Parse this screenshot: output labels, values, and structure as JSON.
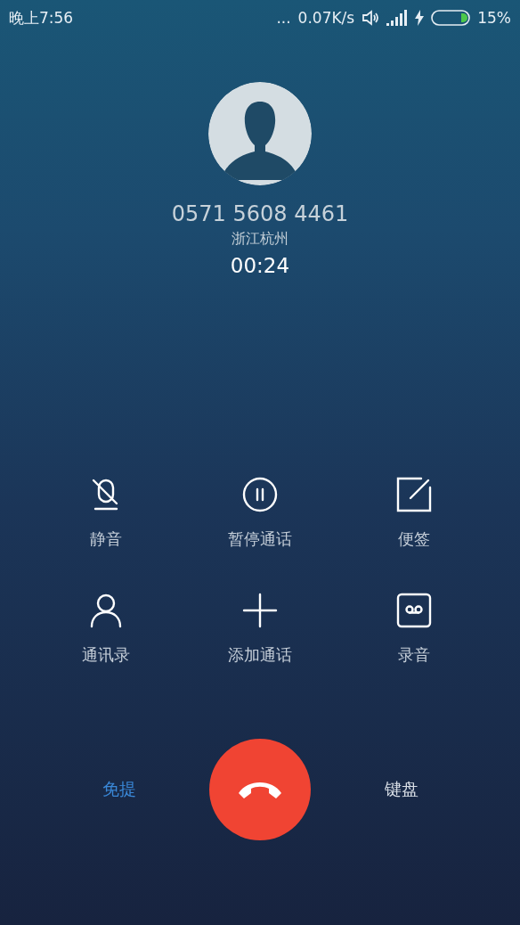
{
  "status_bar": {
    "time": "晚上7:56",
    "more": "...",
    "speed": "0.07K/s",
    "battery_percent": "15%"
  },
  "call": {
    "number": "0571 5608 4461",
    "location": "浙江杭州",
    "duration": "00:24"
  },
  "actions": [
    {
      "kind": "mute",
      "label": "静音"
    },
    {
      "kind": "hold",
      "label": "暂停通话"
    },
    {
      "kind": "note",
      "label": "便签"
    },
    {
      "kind": "contacts",
      "label": "通讯录"
    },
    {
      "kind": "add",
      "label": "添加通话"
    },
    {
      "kind": "record",
      "label": "录音"
    }
  ],
  "speaker": {
    "label": "免提",
    "on": true
  },
  "keypad": {
    "label": "键盘",
    "on": false
  }
}
